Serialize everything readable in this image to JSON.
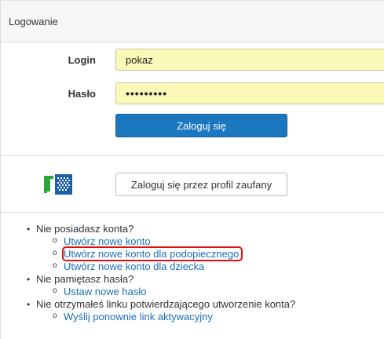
{
  "panel": {
    "title": "Logowanie"
  },
  "form": {
    "login_label": "Login",
    "login_value": "pokaz",
    "password_label": "Hasło",
    "password_value": "•••••••••",
    "submit_label": "Zaloguj się"
  },
  "trusted_profile": {
    "logo_icon": "profil-zaufany-logo",
    "button_label": "Zaloguj się przez profil zaufany",
    "colors": {
      "logo_green": "#2aa63a",
      "logo_blue": "#1f5ea8"
    }
  },
  "links": [
    {
      "question": "Nie posiadasz konta?",
      "items": [
        {
          "label": "Utwórz nowe konto",
          "highlighted": false
        },
        {
          "label": "Utwórz nowe konto dla podopiecznego",
          "highlighted": true
        },
        {
          "label": "Utwórz nowe konto dla dziecka",
          "highlighted": false
        }
      ]
    },
    {
      "question": "Nie pamiętasz hasła?",
      "items": [
        {
          "label": "Ustaw nowe hasło",
          "highlighted": false
        }
      ]
    },
    {
      "question": "Nie otrzymałeś linku potwierdzającego utworzenie konta?",
      "items": [
        {
          "label": "Wyślij ponownie link aktywacyjny",
          "highlighted": false
        }
      ]
    }
  ],
  "colors": {
    "primary_button": "#1b78bf",
    "input_bg": "#fbf9b8",
    "link": "#1a6fb5",
    "highlight_border": "#e01010"
  }
}
